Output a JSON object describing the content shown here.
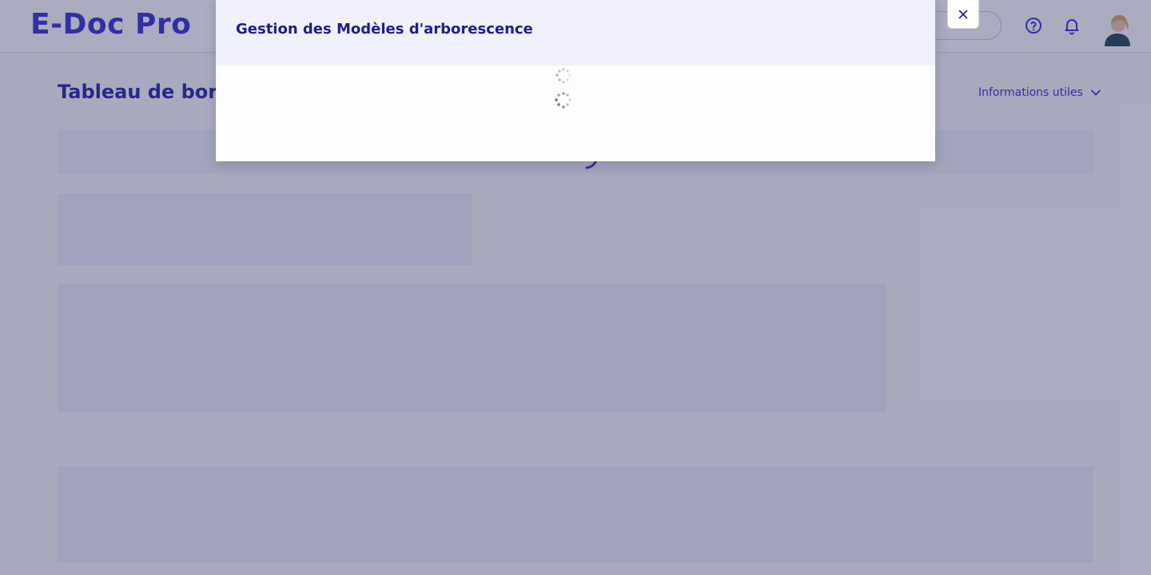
{
  "app": {
    "logo_text": "E-Doc Pro"
  },
  "header": {
    "help_icon": "question-circle-icon",
    "notifications_icon": "bell-icon",
    "avatar": "user-avatar"
  },
  "dashboard": {
    "title": "Tableau de bord",
    "info_link": "Informations utiles"
  },
  "modal": {
    "title": "Gestion des Modèles d'arborescence",
    "close_icon": "close-icon",
    "loading_icon": "spinner-icon"
  },
  "colors": {
    "brand": "#3b36d6",
    "title_dark": "#1f1c8f",
    "modal_header_bg": "#f0f1fd",
    "overlay": "rgba(33,38,88,0.38)"
  }
}
